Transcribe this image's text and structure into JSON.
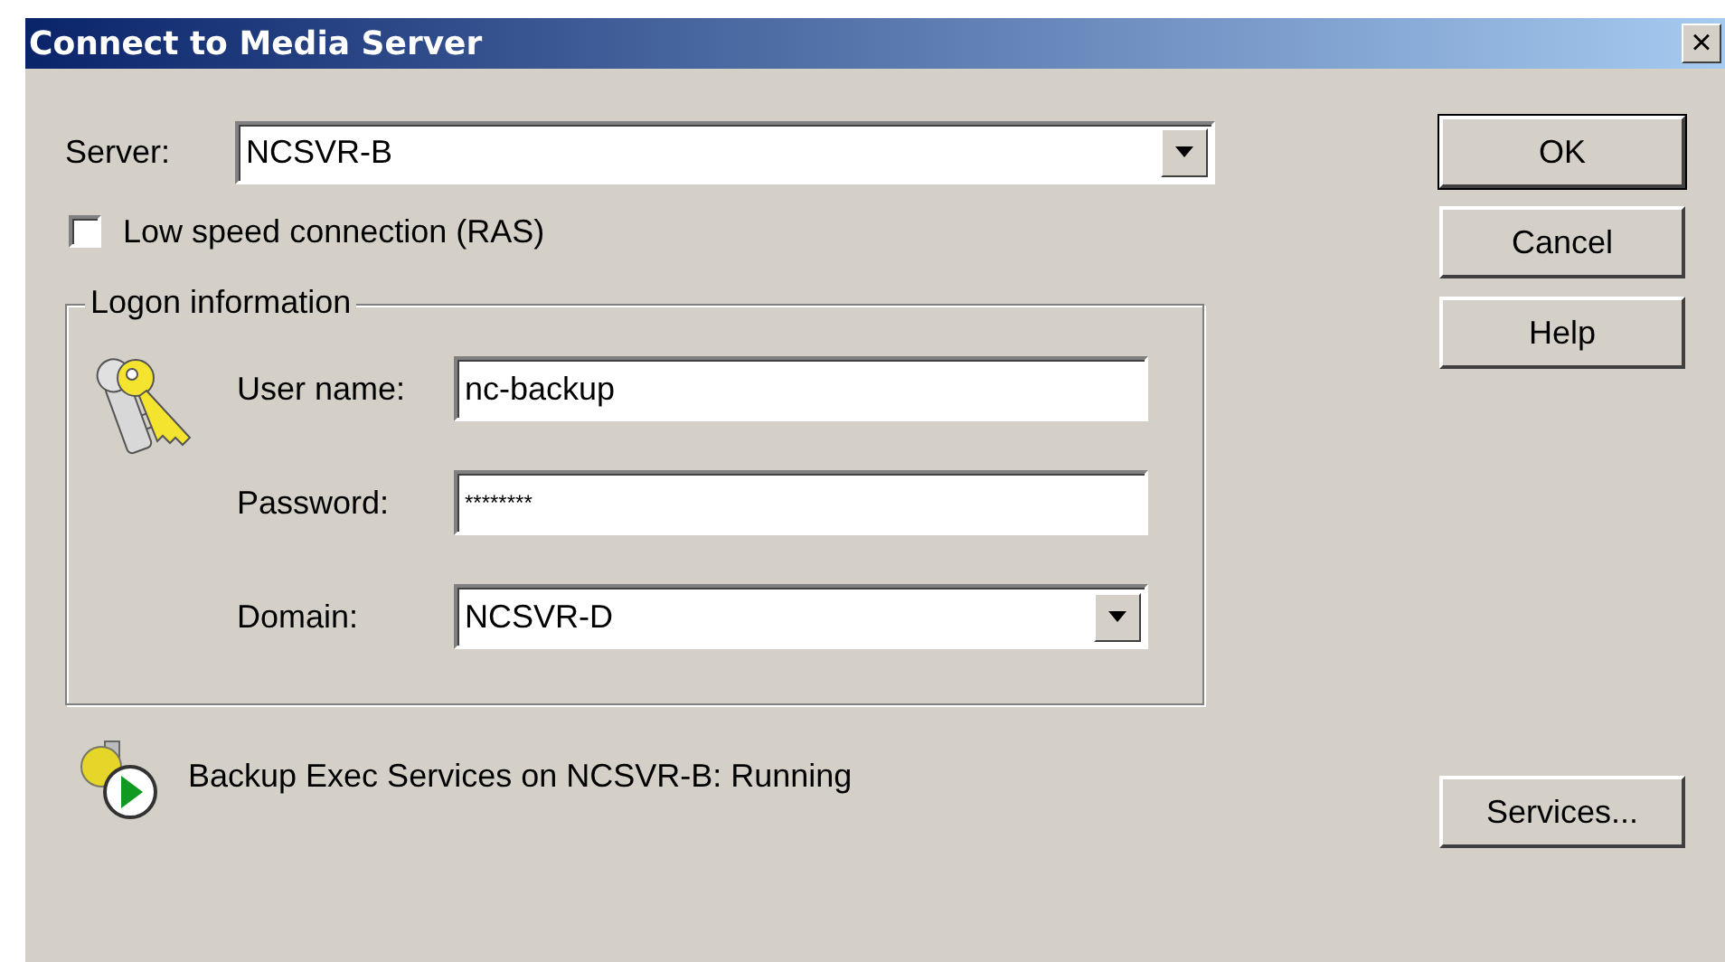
{
  "window": {
    "title": "Connect to Media Server",
    "close": "×"
  },
  "server": {
    "label": "Server:",
    "value": "NCSVR-B"
  },
  "low_speed": {
    "label": "Low speed connection (RAS)",
    "checked": false
  },
  "logon": {
    "title": "Logon information",
    "fields": [
      {
        "kind": "text",
        "label": "User name:",
        "value": "nc-backup"
      },
      {
        "kind": "password",
        "label": "Password:",
        "value": "********"
      },
      {
        "kind": "combo",
        "label": "Domain:",
        "value": "NCSVR-D"
      }
    ]
  },
  "buttons": [
    {
      "label": "OK",
      "default": true
    },
    {
      "label": "Cancel",
      "default": false
    },
    {
      "label": "Help",
      "default": false
    }
  ],
  "status": {
    "text": "Backup Exec Services on NCSVR-B: Running",
    "running": true
  },
  "services_button": {
    "label": "Services..."
  }
}
